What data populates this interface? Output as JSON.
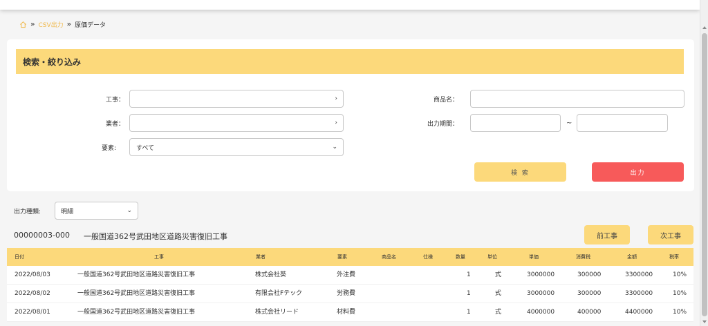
{
  "breadcrumb": {
    "home_icon": "home-icon",
    "link": "CSV出力",
    "current": "原価データ"
  },
  "search": {
    "header": "検索・絞り込み",
    "labels": {
      "project": "工事：",
      "vendor": "業者：",
      "element": "要素:",
      "product": "商品名：",
      "period": "出力期間："
    },
    "element_value": "すべて",
    "tilde": "~",
    "search_button": "検 索",
    "output_button": "出力"
  },
  "output_type": {
    "label": "出力種類:",
    "value": "明細"
  },
  "project": {
    "code": "00000003-000",
    "name": "一般国道362号武田地区道路災害復旧工事",
    "prev_button": "前工事",
    "next_button": "次工事"
  },
  "table": {
    "columns": [
      "日付",
      "工事",
      "業者",
      "要素",
      "商品名",
      "仕様",
      "数量",
      "単位",
      "単価",
      "消費税",
      "金額",
      "税率"
    ],
    "rows": [
      [
        "2022/08/03",
        "一般国道362号武田地区道路災害復旧工事",
        "株式会社葵",
        "外注費",
        "",
        "",
        "1",
        "式",
        "3000000",
        "300000",
        "3300000",
        "10%"
      ],
      [
        "2022/08/02",
        "一般国道362号武田地区道路災害復旧工事",
        "有限会社Fテック",
        "労務費",
        "",
        "",
        "1",
        "式",
        "3000000",
        "300000",
        "3300000",
        "10%"
      ],
      [
        "2022/08/01",
        "一般国道362号武田地区道路災害復旧工事",
        "株式会社リード",
        "材料費",
        "",
        "",
        "1",
        "式",
        "4000000",
        "400000",
        "4400000",
        "10%"
      ]
    ]
  },
  "colors": {
    "accent": "#fcd97b",
    "danger": "#f75a5a",
    "link": "#f0b84a"
  }
}
